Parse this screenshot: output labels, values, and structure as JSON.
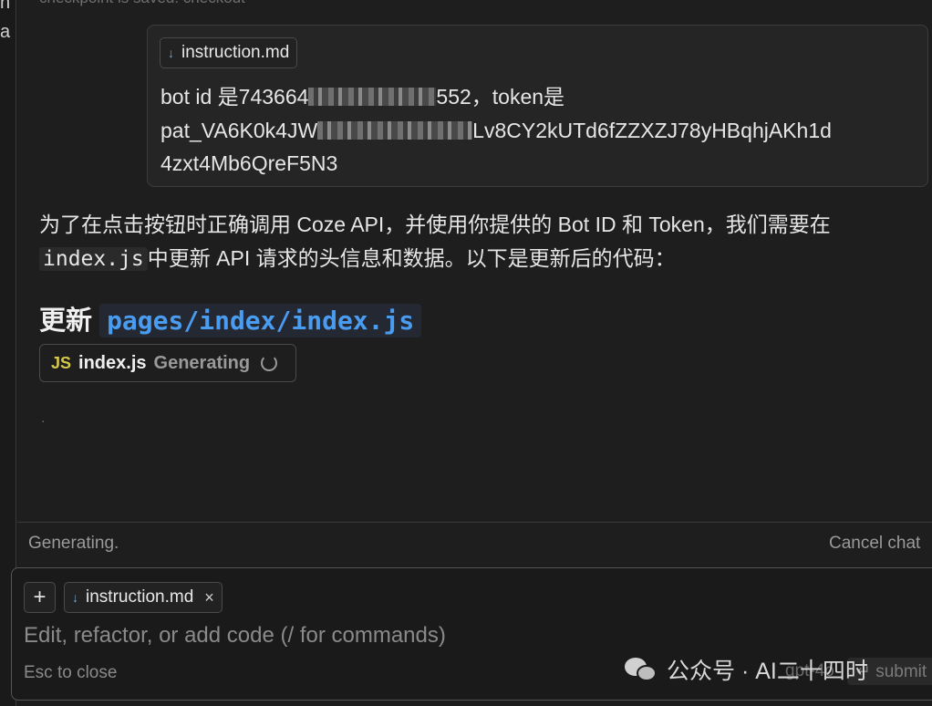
{
  "gutter": {
    "line1": "n",
    "line2": "a"
  },
  "chat": {
    "checkpoint_text": "checkpoint is saved: checkout",
    "user_message": {
      "attachment": "instruction.md",
      "text_part1": "bot id 是743664",
      "text_part2": "552，token是",
      "text_part3": "pat_VA6K0k4JW",
      "text_part4": "Lv8CY2kUTd6fZZXZJ78yHBqhjAKh1d",
      "text_part5": "4zxt4Mb6QreF5N3"
    },
    "reply": {
      "text_before": "为了在点击按钮时正确调用 Coze API，并使用你提供的 Bot ID 和 Token，我们需要在",
      "code": "index.js",
      "text_after": "中更新 API 请求的头信息和数据。以下是更新后的代码："
    },
    "heading": {
      "prefix": "更新",
      "path": "pages/index/index.js"
    },
    "file_block": {
      "icon_label": "JS",
      "name": "index.js",
      "status": "Generating"
    },
    "trailing_dot": "."
  },
  "status_bar": {
    "left": "Generating.",
    "right": "Cancel chat"
  },
  "input": {
    "plus": "+",
    "attachment": "instruction.md",
    "close": "×",
    "placeholder": "Edit, refactor, or add code (/ for commands)",
    "esc_hint": "Esc to close",
    "model": "gpt-4o",
    "submit": "↵ submit"
  },
  "watermark": {
    "text": "公众号 · AI二十四时"
  }
}
